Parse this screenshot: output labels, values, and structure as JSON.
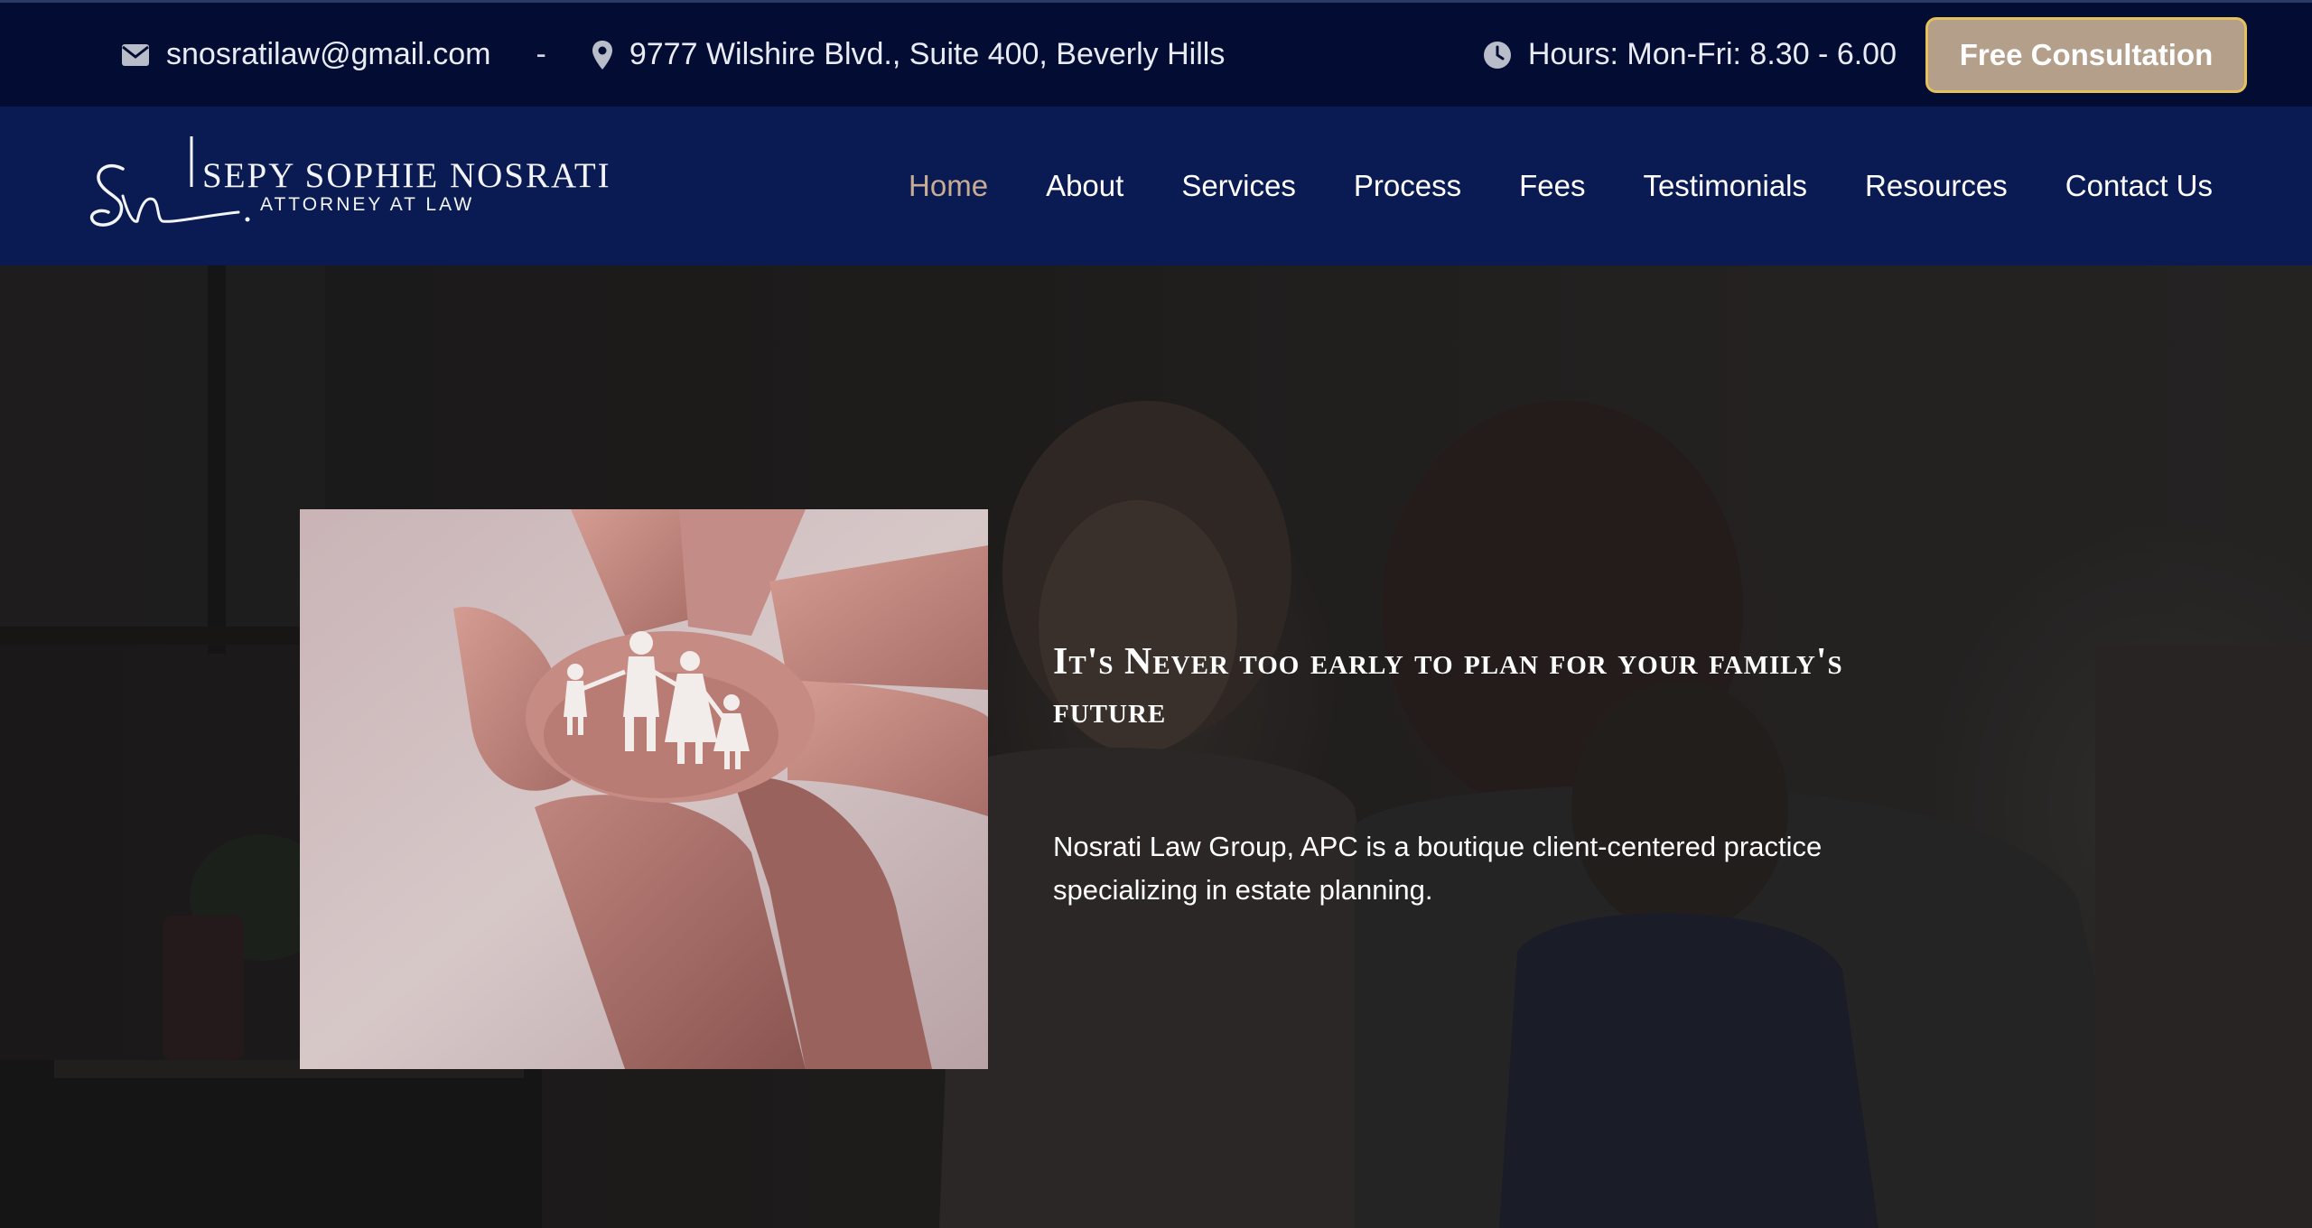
{
  "topbar": {
    "email": "snosratilaw@gmail.com",
    "separator": "-",
    "address": "9777 Wilshire Blvd., Suite 400, Beverly Hills",
    "hours": "Hours: Mon-Fri: 8.30 - 6.00",
    "cta_label": "Free Consultation",
    "icons": [
      "envelope-icon",
      "map-pin-icon",
      "clock-icon"
    ]
  },
  "logo": {
    "name": "SEPY SOPHIE NOSRATI",
    "subtitle": "ATTORNEY AT LAW"
  },
  "nav": {
    "items": [
      {
        "label": "Home",
        "active": true
      },
      {
        "label": "About",
        "active": false
      },
      {
        "label": "Services",
        "active": false
      },
      {
        "label": "Process",
        "active": false
      },
      {
        "label": "Fees",
        "active": false
      },
      {
        "label": "Testimonials",
        "active": false
      },
      {
        "label": "Resources",
        "active": false
      },
      {
        "label": "Contact Us",
        "active": false
      }
    ]
  },
  "hero": {
    "title": "It's Never too early to plan for your family's future",
    "description": "Nosrati Law Group, APC is a boutique client-centered practice specializing in estate planning."
  },
  "colors": {
    "topbar_bg": "#030d33",
    "navbar_bg": "#0a1a52",
    "accent": "#c8ad94",
    "cta_bg": "#b39f8a",
    "cta_border": "#e3c15c"
  }
}
